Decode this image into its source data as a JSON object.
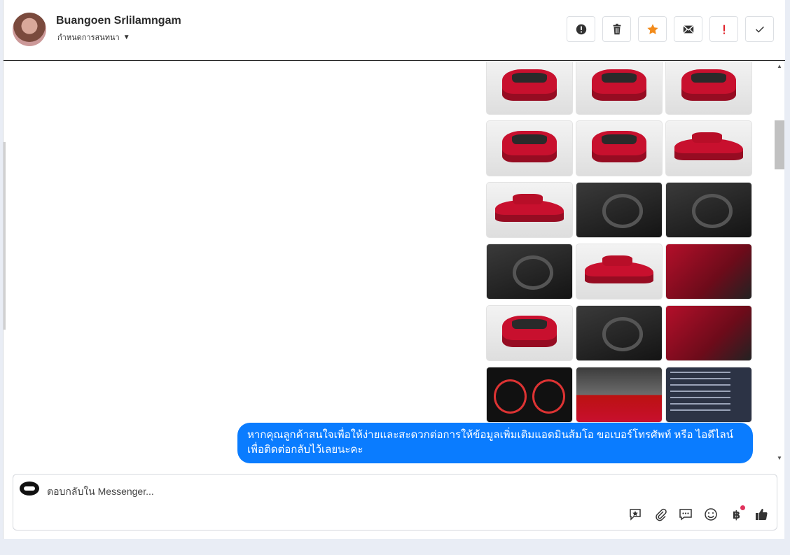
{
  "header": {
    "contact_name": "Buangoen Srlilamngam",
    "subtitle": "กำหนดการสนทนา",
    "actions": [
      {
        "icon": "alert-circle-icon",
        "name": "report-button"
      },
      {
        "icon": "trash-icon",
        "name": "delete-button"
      },
      {
        "icon": "star-icon",
        "name": "star-button"
      },
      {
        "icon": "mail-icon",
        "name": "mark-unread-button"
      },
      {
        "icon": "exclamation-icon",
        "name": "priority-button"
      },
      {
        "icon": "check-icon",
        "name": "done-button"
      }
    ]
  },
  "thread": {
    "message_text_line1": "หากคุณลูกค้าสนใจเพื่อให้ง่ายและสะดวกต่อการให้ข้อมูลเพิ่มเติมแอดมินส้มโอ ขอเบอร์โทรศัพท์ หรือ ไอดีไลน์",
    "message_text_line2": "เพื่อติดต่อกลับไว้เลยนะคะ",
    "bubble_color": "#0a7cff"
  },
  "composer": {
    "placeholder": "ตอบกลับใน Messenger...",
    "tools": [
      "saved-reply-icon",
      "attachment-icon",
      "chat-bubbles-icon",
      "emoji-icon",
      "baht-icon",
      "thumbs-up-icon"
    ]
  },
  "colors": {
    "accent_star": "#f28b1b",
    "priority_red": "#e0222a",
    "notification_dot": "#e0325c"
  }
}
